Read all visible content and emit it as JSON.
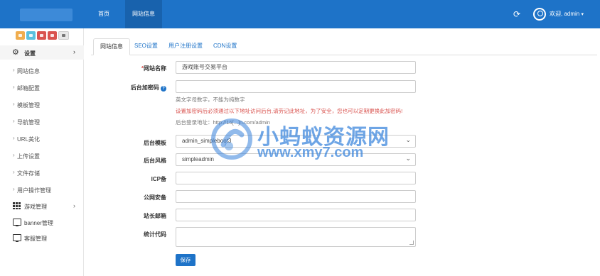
{
  "topbar": {
    "nav": [
      {
        "label": "首页"
      },
      {
        "label": "网站信息"
      }
    ],
    "refresh_icon": "refresh-icon",
    "user_icon": "user-circle-icon",
    "welcome": "欢迎, admin",
    "caret": "▾",
    "color": "#1e73c8"
  },
  "sidebar": {
    "shortcut_icons": [
      "shortcut-orange-icon",
      "shortcut-blue-icon",
      "shortcut-red-icon",
      "shortcut-red-icon",
      "shortcut-list-icon"
    ],
    "settings": {
      "label": "设置",
      "icon": "gear-icon",
      "chevron": "›"
    },
    "sub_items": [
      {
        "label": "网站信息"
      },
      {
        "label": "邮箱配置"
      },
      {
        "label": "模板管理"
      },
      {
        "label": "导航管理"
      },
      {
        "label": "URL美化"
      },
      {
        "label": "上传设置"
      },
      {
        "label": "文件存储"
      },
      {
        "label": "用户操作管理"
      }
    ],
    "groups": [
      {
        "label": "游戏管理",
        "icon": "grid-icon",
        "chevron": "›"
      },
      {
        "label": "banner管理",
        "icon": "monitor-icon"
      },
      {
        "label": "客服管理",
        "icon": "monitor-icon"
      }
    ]
  },
  "tabs": [
    {
      "label": "网站信息",
      "active": true
    },
    {
      "label": "SEO设置"
    },
    {
      "label": "用户注册设置"
    },
    {
      "label": "CDN设置"
    }
  ],
  "form": {
    "site_name": {
      "label": "网站名称",
      "required_mark": "*",
      "value": "游戏账号交易平台"
    },
    "admin_code": {
      "label": "后台加密码",
      "help_icon": "?",
      "value": "",
      "hint": "英文字母数字，不能为纯数字",
      "warning": "设置加密码后必须通过以下地址访问后台,请劳记此地址，为了安全，您也可以定期更换此加密码!",
      "login_url": "后台登录地址：http://16[...]n.com/admin"
    },
    "admin_template": {
      "label": "后台模板",
      "value": "admin_simpleboot3"
    },
    "admin_style": {
      "label": "后台风格",
      "value": "simpleadmin"
    },
    "icp": {
      "label": "ICP备",
      "value": ""
    },
    "police": {
      "label": "公网安备",
      "value": ""
    },
    "email": {
      "label": "站长邮箱",
      "value": ""
    },
    "stats_code": {
      "label": "统计代码",
      "value": ""
    },
    "save_label": "保存"
  },
  "watermark": {
    "title": "小蚂蚁资源网",
    "url": "www.xmy7.com"
  }
}
